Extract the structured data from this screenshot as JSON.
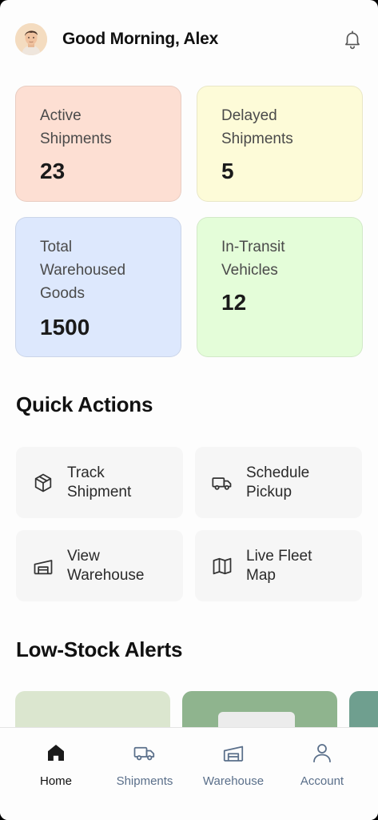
{
  "header": {
    "greeting": "Good Morning, Alex",
    "avatar_icon": "user-avatar",
    "notification_icon": "bell-icon"
  },
  "stats": [
    {
      "label": "Active\nShipments",
      "value": "23",
      "color": "#fddfd3"
    },
    {
      "label": "Delayed\nShipments",
      "value": "5",
      "color": "#fdfbd8"
    },
    {
      "label": "Total\nWarehoused\nGoods",
      "value": "1500",
      "color": "#dde8fd"
    },
    {
      "label": "In-Transit\nVehicles",
      "value": "12",
      "color": "#e4fdd9"
    }
  ],
  "quick_actions": {
    "title": "Quick Actions",
    "items": [
      {
        "label": "Track\nShipment",
        "icon": "package-icon"
      },
      {
        "label": "Schedule\nPickup",
        "icon": "truck-icon"
      },
      {
        "label": "View\nWarehouse",
        "icon": "warehouse-icon"
      },
      {
        "label": "Live Fleet\nMap",
        "icon": "map-icon"
      }
    ]
  },
  "alerts": {
    "title": "Low-Stock Alerts"
  },
  "bottom_nav": {
    "items": [
      {
        "label": "Home",
        "icon": "home-icon",
        "active": true
      },
      {
        "label": "Shipments",
        "icon": "truck-icon",
        "active": false
      },
      {
        "label": "Warehouse",
        "icon": "warehouse-icon",
        "active": false
      },
      {
        "label": "Account",
        "icon": "user-icon",
        "active": false
      }
    ]
  }
}
